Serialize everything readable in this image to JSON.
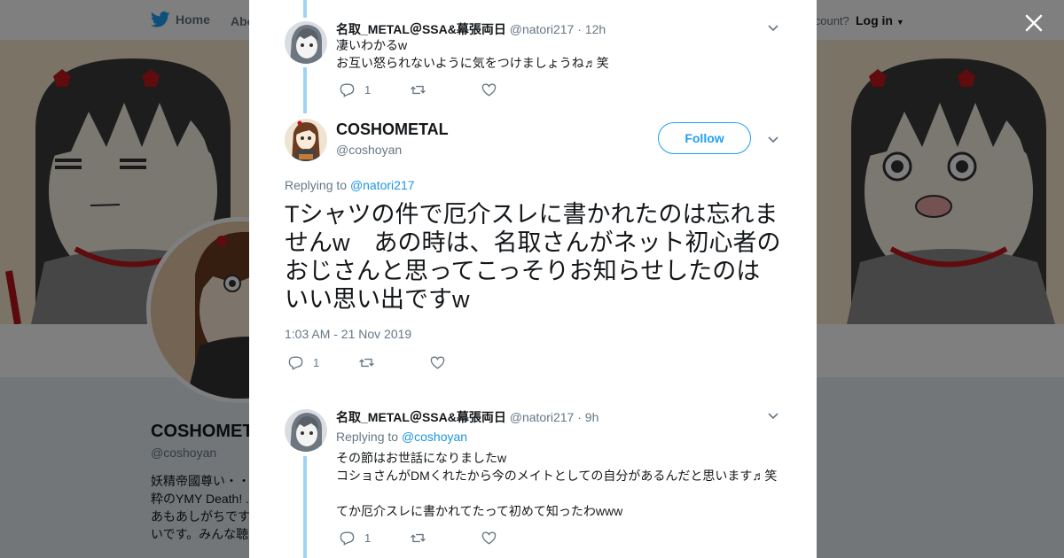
{
  "nav": {
    "home": "Home",
    "about": "Abo",
    "account": "account?",
    "login": "Log in"
  },
  "profile_bg": {
    "name": "COSHOMET",
    "handle": "@coshoyan",
    "bio": "妖精帝國尊い・・\n粋のYMY Death! ..\nあもあしがちです\nいです。みんな聴"
  },
  "tweets": [
    {
      "name": "名取_METAL＠SSA&幕張両日",
      "handle": "@natori217",
      "dot": "·",
      "time": "12h",
      "text": "凄いわかるw\nお互い怒られないように気をつけましょうね♬笑",
      "reply_count": "1"
    },
    {
      "name": "名取_METAL＠SSA&幕張両日",
      "handle": "@natori217",
      "dot": "·",
      "time": "9h",
      "replying_label": "Replying to",
      "replying_to": "@coshoyan",
      "text": "その節はお世話になりましたw\nコショさんがDMくれたから今のメイトとしての自分があるんだと思います♬笑\n\nてか厄介スレに書かれてたって初めて知ったわwww",
      "reply_count": "1"
    }
  ],
  "main_tweet": {
    "name": "COSHOMETAL",
    "handle": "@coshoyan",
    "follow_label": "Follow",
    "replying_label": "Replying to",
    "replying_to": "@natori217",
    "text": "Tシャツの件で厄介スレに書かれたのは忘れませんw　あの時は、名取さんがネット初心者のおじさんと思ってこっそりお知らせしたのはいい思い出ですw",
    "date": "1:03 AM - 21 Nov 2019",
    "reply_count": "1"
  },
  "colors": {
    "accent": "#1da1f2",
    "thread_line": "#9fd3f3",
    "overlay": "rgba(0,0,0,0.5)"
  }
}
